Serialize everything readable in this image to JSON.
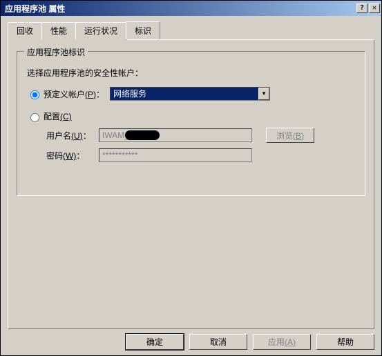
{
  "window": {
    "title": "应用程序池 属性",
    "help_btn": "?",
    "close_btn": "✕"
  },
  "tabs": {
    "items": [
      {
        "label": "回收"
      },
      {
        "label": "性能"
      },
      {
        "label": "运行状况"
      },
      {
        "label": "标识"
      }
    ],
    "active_index": 3
  },
  "group": {
    "legend": "应用程序池标识",
    "prompt": "选择应用程序池的安全性帐户：",
    "predefined": {
      "label_prefix": "预定义帐户",
      "accel": "(P)",
      "selected": "网络服务"
    },
    "configure": {
      "label_prefix": "配置",
      "accel": "(C)"
    },
    "username": {
      "label": "用户名",
      "accel": "(U)",
      "colon": "：",
      "value_prefix": "IWAM_"
    },
    "password": {
      "label": "密码",
      "accel": "(W)",
      "colon": "：",
      "value": "***********"
    },
    "browse": {
      "label": "浏览",
      "accel": "(B)"
    }
  },
  "buttons": {
    "ok": "确定",
    "cancel": "取消",
    "apply_label": "应用",
    "apply_accel": "(A)",
    "help": "帮助"
  }
}
